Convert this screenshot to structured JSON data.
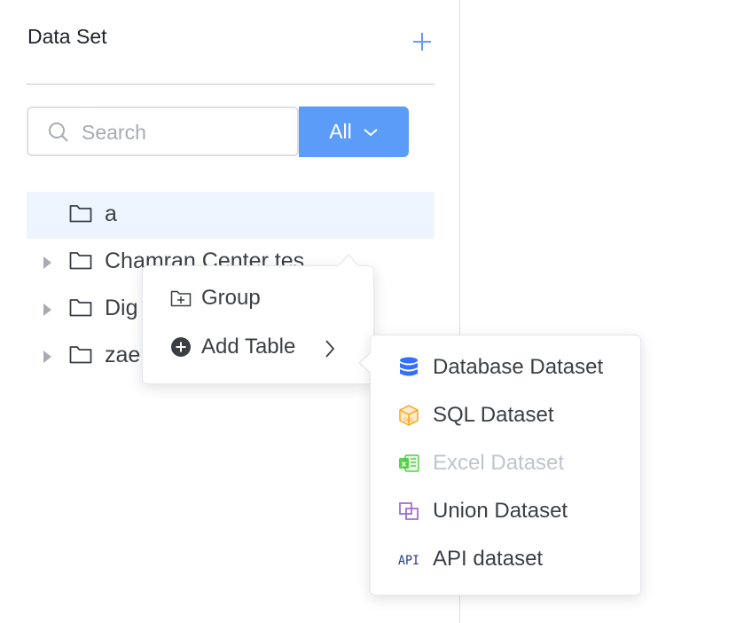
{
  "panel": {
    "title": "Data Set",
    "add_icon": "plus-icon"
  },
  "search": {
    "placeholder": "Search",
    "value": "",
    "icon": "search-icon"
  },
  "filter": {
    "label": "All",
    "icon": "chevron-down-icon"
  },
  "tree": {
    "items": [
      {
        "label": "a",
        "expandable": false,
        "selected": true,
        "icon": "folder-icon"
      },
      {
        "label": "Chamran Center tes",
        "expandable": true,
        "selected": false,
        "icon": "folder-icon"
      },
      {
        "label": "Dig",
        "expandable": true,
        "selected": false,
        "icon": "folder-icon"
      },
      {
        "label": "zae",
        "expandable": true,
        "selected": false,
        "icon": "folder-icon"
      }
    ]
  },
  "context_menu": {
    "group": {
      "label": "Group",
      "icon": "folder-add-icon"
    },
    "add_table": {
      "label": "Add Table",
      "icon": "plus-circle-icon",
      "submenu_icon": "chevron-right-icon"
    }
  },
  "submenu": {
    "items": [
      {
        "label": "Database Dataset",
        "icon": "database-icon",
        "disabled": false
      },
      {
        "label": "SQL Dataset",
        "icon": "sql-icon",
        "disabled": false
      },
      {
        "label": "Excel Dataset",
        "icon": "excel-icon",
        "disabled": true
      },
      {
        "label": "Union Dataset",
        "icon": "union-icon",
        "disabled": false
      },
      {
        "label": "API dataset",
        "icon": "api-icon",
        "disabled": false
      }
    ]
  },
  "colors": {
    "accent": "#5a9cf8",
    "selected_row": "#eef5fe",
    "database": "#3370ff",
    "sql": "#f5a623",
    "excel": "#34c724",
    "union": "#9f6fd8",
    "api": "#1f3a8a"
  }
}
